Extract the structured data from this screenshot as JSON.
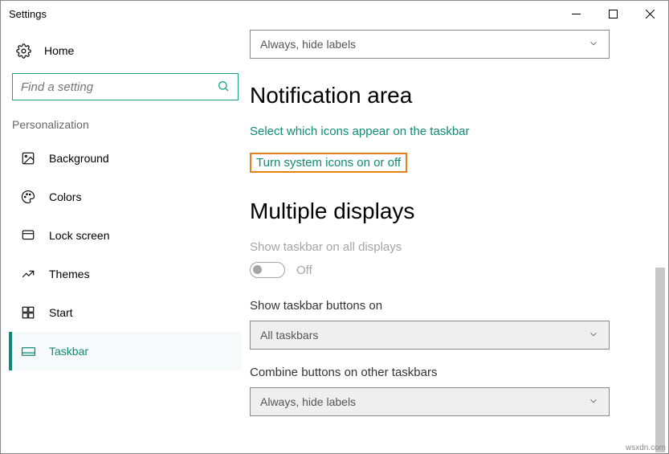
{
  "window": {
    "title": "Settings"
  },
  "sidebar": {
    "home": "Home",
    "search_placeholder": "Find a setting",
    "section": "Personalization",
    "items": [
      {
        "label": "Background"
      },
      {
        "label": "Colors"
      },
      {
        "label": "Lock screen"
      },
      {
        "label": "Themes"
      },
      {
        "label": "Start"
      },
      {
        "label": "Taskbar"
      }
    ]
  },
  "content": {
    "dropdown_top": "Always, hide labels",
    "section_notification": "Notification area",
    "link_select_icons": "Select which icons appear on the taskbar",
    "link_system_icons": "Turn system icons on or off",
    "section_multiple": "Multiple displays",
    "label_show_all": "Show taskbar on all displays",
    "toggle_state": "Off",
    "label_show_buttons": "Show taskbar buttons on",
    "dd_all_taskbars": "All taskbars",
    "label_combine": "Combine buttons on other taskbars",
    "dd_combine": "Always, hide labels"
  },
  "watermark": "wsxdn.com"
}
